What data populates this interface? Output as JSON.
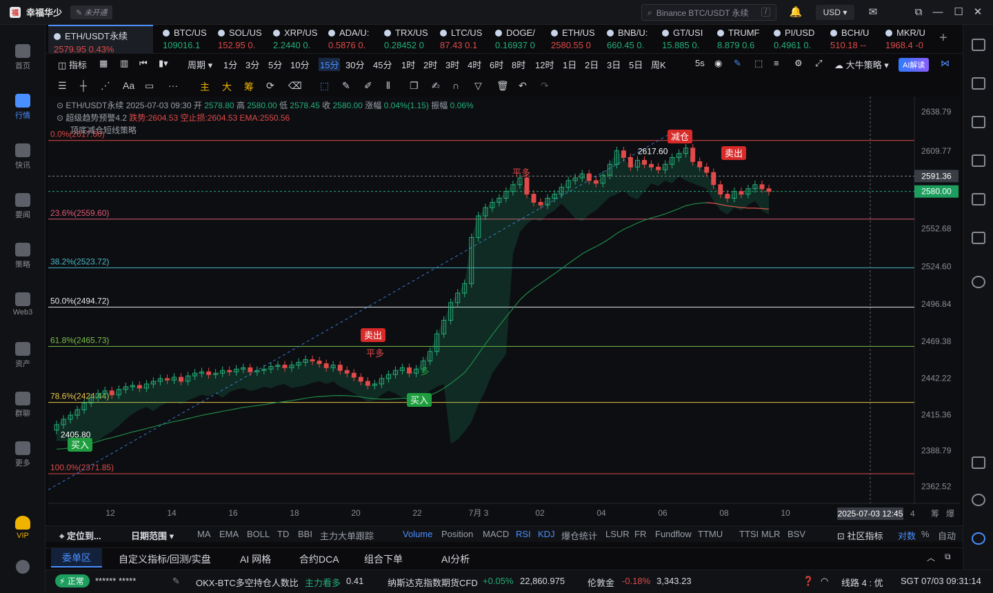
{
  "titlebar": {
    "app_name": "幸福华少",
    "status": "未开通",
    "search_placeholder": "Binance BTC/USDT 永续",
    "search_shortcut": "/",
    "currency": "USD"
  },
  "sidebar": {
    "items": [
      {
        "label": "首页",
        "icon": "home-icon"
      },
      {
        "label": "行情",
        "icon": "market-icon",
        "active": true
      },
      {
        "label": "快讯",
        "icon": "news-icon"
      },
      {
        "label": "要闻",
        "icon": "headline-icon"
      },
      {
        "label": "策略",
        "icon": "strategy-icon"
      },
      {
        "label": "Web3",
        "icon": "web3-icon"
      },
      {
        "label": "资产",
        "icon": "wallet-icon"
      },
      {
        "label": "群聊",
        "icon": "chat-icon"
      },
      {
        "label": "更多",
        "icon": "more-icon"
      },
      {
        "label": "VIP",
        "icon": "vip-icon"
      }
    ]
  },
  "tabs": [
    {
      "name": "ETH/USDT永续",
      "price": "2579.95",
      "change": "0.43%",
      "dir": "dn",
      "active": true
    },
    {
      "name": "BTC/US",
      "price": "109016.1",
      "change": "",
      "dir": "up"
    },
    {
      "name": "SOL/US",
      "price": "152.95",
      "change": "0.",
      "dir": "dn"
    },
    {
      "name": "XRP/US",
      "price": "2.2440",
      "change": "0.",
      "dir": "up"
    },
    {
      "name": "ADA/U:",
      "price": "0.5876",
      "change": "0.",
      "dir": "dn"
    },
    {
      "name": "TRX/US",
      "price": "0.28452",
      "change": "0",
      "dir": "up"
    },
    {
      "name": "LTC/US",
      "price": "87.43",
      "change": "0.1",
      "dir": "dn"
    },
    {
      "name": "DOGE/",
      "price": "0.16937",
      "change": "0",
      "dir": "up"
    },
    {
      "name": "ETH/US",
      "price": "2580.55",
      "change": "0",
      "dir": "dn"
    },
    {
      "name": "BNB/U:",
      "price": "660.45",
      "change": "0.",
      "dir": "up"
    },
    {
      "name": "GT/USI",
      "price": "15.885",
      "change": "0.",
      "dir": "up"
    },
    {
      "name": "TRUMF",
      "price": "8.879",
      "change": "0.6",
      "dir": "up"
    },
    {
      "name": "PI/USD",
      "price": "0.4961",
      "change": "0.",
      "dir": "up"
    },
    {
      "name": "BCH/U",
      "price": "510.18",
      "change": "--",
      "dir": "dn"
    },
    {
      "name": "MKR/U",
      "price": "1968.4",
      "change": "-0",
      "dir": "dn"
    }
  ],
  "toolbar": {
    "indicator": "指标",
    "period": "周期",
    "intervals": [
      "1分",
      "3分",
      "5分",
      "10分",
      "15分",
      "30分",
      "45分",
      "1时",
      "2时",
      "3时",
      "4时",
      "6时",
      "8时",
      "12时",
      "1日",
      "2日",
      "3日",
      "5日",
      "周K"
    ],
    "selected_interval": "15分",
    "second_interval": "5s",
    "strategy": "大牛策略",
    "ai_label": "AI解读"
  },
  "drawing_tools": [
    "主",
    "大",
    "筹"
  ],
  "legend": {
    "line1_symbol": "ETH/USDT永续",
    "line1_time": "2025-07-03 09:30",
    "open_label": "开",
    "open": "2578.80",
    "high_label": "高",
    "high": "2580.00",
    "low_label": "低",
    "low": "2578.45",
    "close_label": "收",
    "close": "2580.00",
    "chg_label": "涨幅",
    "chg": "0.04%(1.15)",
    "amp_label": "振幅",
    "amp": "0.06%",
    "line2_name": "超级趋势预警4.2",
    "line2_vals": "跌势:2604.53  空止损:2604.53  EMA:2550.56",
    "line3_name": "顶底减仓短线策略"
  },
  "chart_data": {
    "type": "candlestick",
    "symbol": "ETH/USDT永续",
    "interval": "15分",
    "y_range": [
      2350,
      2650
    ],
    "y_ticks": [
      "2638.79",
      "2609.77",
      "2580.00",
      "2552.68",
      "2524.60",
      "2496.84",
      "2469.38",
      "2442.22",
      "2415.36",
      "2388.79",
      "2362.52"
    ],
    "x_ticks": [
      "12",
      "14",
      "16",
      "18",
      "20",
      "22",
      "7月 3",
      "02",
      "04",
      "06",
      "08",
      "10"
    ],
    "fib_levels": [
      {
        "label": "0.0%(2617.60)",
        "value": 2617.6,
        "color": "#e04a4a"
      },
      {
        "label": "23.6%(2559.60)",
        "value": 2559.6,
        "color": "#e05a7a"
      },
      {
        "label": "38.2%(2523.72)",
        "value": 2523.72,
        "color": "#4ab8c8"
      },
      {
        "label": "50.0%(2494.72)",
        "value": 2494.72,
        "color": "#e8e8e8"
      },
      {
        "label": "61.8%(2465.73)",
        "value": 2465.73,
        "color": "#7ac04a"
      },
      {
        "label": "78.6%(2424.44)",
        "value": 2424.44,
        "color": "#e8c84a"
      },
      {
        "label": "100.0%(2371.85)",
        "value": 2371.85,
        "color": "#e04a4a"
      }
    ],
    "price_tags": [
      {
        "label": "2591.36",
        "value": 2591.36
      },
      {
        "label": "2580.00",
        "value": 2580.0
      }
    ],
    "high_mark": "2617.60",
    "low_mark": "2405.80",
    "crosshair_time": "2025-07-03 12:45",
    "crosshair_right": "4",
    "signals": [
      {
        "label": "减仓",
        "type": "sell"
      },
      {
        "label": "卖出",
        "type": "sell"
      },
      {
        "label": "平多",
        "type": "text"
      },
      {
        "label": "卖出",
        "type": "sell"
      },
      {
        "label": "平多",
        "type": "text"
      },
      {
        "label": "买入",
        "type": "buy"
      },
      {
        "label": "买入",
        "type": "buy"
      },
      {
        "label": "多",
        "type": "text"
      }
    ],
    "closes": [
      2408,
      2412,
      2415,
      2419,
      2424,
      2428,
      2431,
      2433,
      2430,
      2434,
      2436,
      2437,
      2435,
      2438,
      2440,
      2442,
      2441,
      2443,
      2440,
      2444,
      2446,
      2447,
      2445,
      2446,
      2448,
      2447,
      2449,
      2450,
      2447,
      2448,
      2449,
      2451,
      2452,
      2450,
      2452,
      2454,
      2456,
      2455,
      2453,
      2450,
      2452,
      2448,
      2446,
      2443,
      2440,
      2437,
      2438,
      2442,
      2445,
      2448,
      2450,
      2446,
      2449,
      2455,
      2462,
      2475,
      2485,
      2498,
      2505,
      2512,
      2546,
      2562,
      2568,
      2572,
      2575,
      2580,
      2585,
      2590,
      2578,
      2572,
      2570,
      2575,
      2578,
      2583,
      2588,
      2590,
      2593,
      2588,
      2586,
      2592,
      2600,
      2610,
      2605,
      2598,
      2603,
      2600,
      2598,
      2596,
      2600,
      2605,
      2608,
      2612,
      2602,
      2598,
      2594,
      2585,
      2578,
      2575,
      2580,
      2578,
      2582,
      2585,
      2582,
      2580
    ]
  },
  "indicators": {
    "locate": "定位到...",
    "date_range": "日期范围",
    "list": [
      "MA",
      "EMA",
      "BOLL",
      "TD",
      "BBI",
      "主力大单跟踪",
      "Volume",
      "Position",
      "MACD",
      "RSI",
      "KDJ",
      "爆仓统计",
      "LSUR",
      "FR",
      "Fundflow",
      "TTMU",
      "TTSI",
      "MLR",
      "BSV"
    ],
    "active": [
      "Volume",
      "RSI",
      "KDJ"
    ],
    "community": "社区指标",
    "log_label": "对数",
    "pct_label": "%",
    "auto_label": "自动",
    "right_a": "筹",
    "right_b": "爆"
  },
  "order_tabs": [
    "委单区",
    "自定义指标/回测/实盘",
    "AI 网格",
    "合约DCA",
    "组合下单",
    "AI分析"
  ],
  "statusbar": {
    "state": "正常",
    "mask": "******  *****",
    "okx_label": "OKX-BTC多空持仓人数比",
    "okx_sentiment": "主力看多",
    "okx_value": "0.41",
    "nasdaq_label": "纳斯达克指数期货CFD",
    "nasdaq_change": "+0.05%",
    "nasdaq_value": "22,860.975",
    "gold_label": "伦敦金",
    "gold_change": "-0.18%",
    "gold_value": "3,343.23",
    "line_label": "线路 4 : 优",
    "clock": "SGT 07/03 09:31:14"
  },
  "colors": {
    "up": "#24b07a",
    "down": "#e04a4a",
    "accent": "#4a8fff",
    "bg": "#0b0b0d"
  }
}
